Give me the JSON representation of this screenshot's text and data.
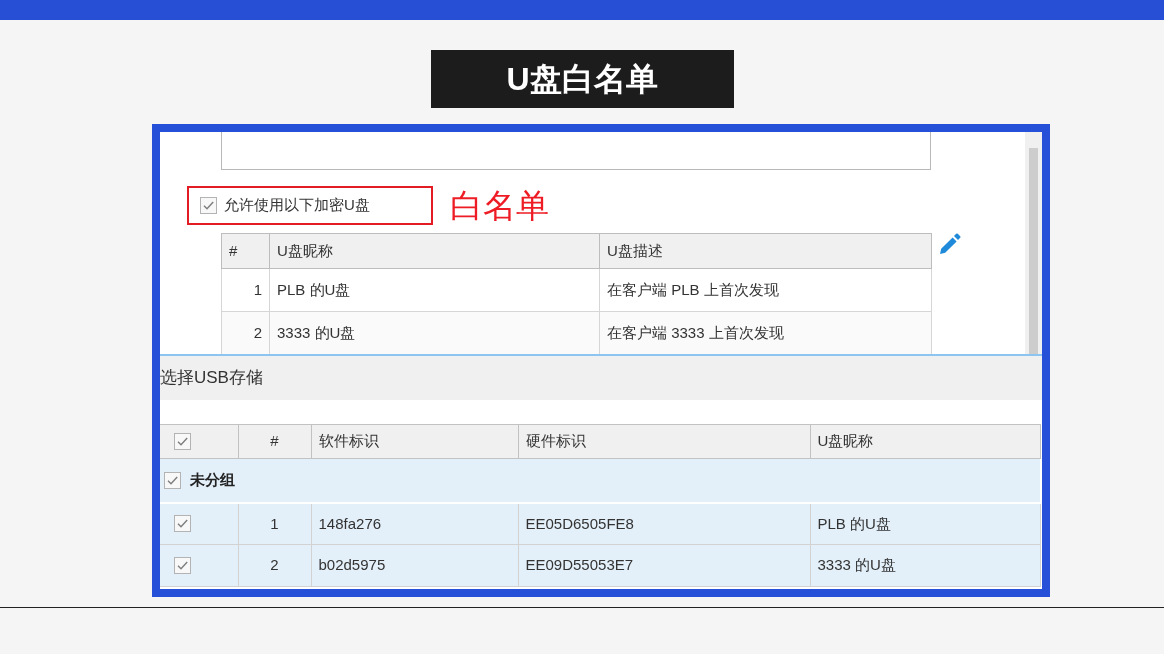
{
  "title": "U盘白名单",
  "whitelist_panel": {
    "allow_checkbox": {
      "label": "允许使用以下加密U盘",
      "checked": true
    },
    "annotation": "白名单",
    "table": {
      "columns": [
        "#",
        "U盘昵称",
        "U盘描述"
      ],
      "rows": [
        {
          "cells": [
            "1",
            "PLB 的U盘",
            "在客户端 PLB 上首次发现"
          ]
        },
        {
          "cells": [
            "2",
            "3333 的U盘",
            "在客户端 3333 上首次发现"
          ]
        }
      ]
    }
  },
  "usb_panel": {
    "title": "选择USB存储",
    "table": {
      "select_all_checked": true,
      "columns": [
        "#",
        "软件标识",
        "硬件标识",
        "U盘昵称"
      ],
      "groups": [
        {
          "label": "未分组",
          "checked": true,
          "rows": [
            {
              "checked": true,
              "cells": [
                "1",
                "148fa276",
                "EE05D6505FE8",
                "PLB 的U盘"
              ]
            },
            {
              "checked": true,
              "cells": [
                "2",
                "b02d5975",
                "EE09D55053E7",
                "3333 的U盘"
              ]
            }
          ]
        }
      ]
    }
  }
}
